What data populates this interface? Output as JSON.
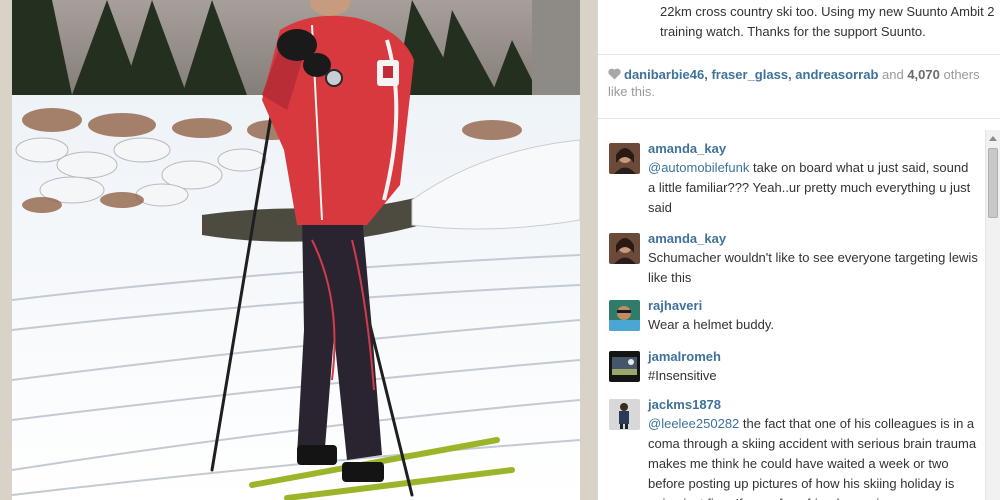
{
  "post": {
    "caption": "22km cross country ski too. Using my new Suunto Ambit 2 training watch. Thanks for the support Suunto.",
    "likes": {
      "users": [
        "danibarbie46",
        "fraser_glass",
        "andreasorrab"
      ],
      "separator_1": ", ",
      "separator_2": ", ",
      "and_text": " and ",
      "count": "4,070",
      "suffix": " others like this."
    }
  },
  "comments": [
    {
      "user": "amanda_kay",
      "mention": "@automobilefunk",
      "text": " take on board what u just said, sound a little familiar??? Yeah..ur pretty much everything u just said"
    },
    {
      "user": "amanda_kay",
      "mention": "",
      "text": "Schumacher wouldn't like to see everyone targeting lewis like this"
    },
    {
      "user": "rajhaveri",
      "mention": "",
      "text": "Wear a helmet buddy."
    },
    {
      "user": "jamalromeh",
      "mention": "",
      "text": "#Insensitive"
    },
    {
      "user": "jackms1878",
      "mention": "@leelee250282",
      "text": " the fact that one of his colleagues is in a coma through a skiing accident with serious brain trauma makes me think he could have waited a week or two before posting up pictures of how his skiing holiday is going just fine. If one of my friends was in a"
    }
  ],
  "icons": {
    "likes": "heart-icon",
    "scroll_up": "chevron-up-icon"
  },
  "colors": {
    "link": "#3f729b",
    "text": "#333333",
    "muted": "#9a9a9a"
  }
}
